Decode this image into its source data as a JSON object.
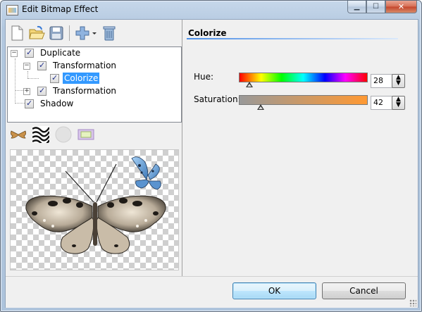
{
  "window": {
    "title": "Edit Bitmap Effect"
  },
  "tree": {
    "items": [
      {
        "label": "Duplicate"
      },
      {
        "label": "Transformation"
      },
      {
        "label": "Colorize"
      },
      {
        "label": "Transformation"
      },
      {
        "label": "Shadow"
      }
    ]
  },
  "panel": {
    "title": "Colorize",
    "hue": {
      "label": "Hue:",
      "value": "28",
      "position_fraction": 0.078
    },
    "saturation": {
      "label": "Saturation:",
      "value": "42",
      "position_fraction": 0.17
    }
  },
  "buttons": {
    "ok": "OK",
    "cancel": "Cancel"
  },
  "icons": [
    "new-document-icon",
    "open-folder-icon",
    "save-disk-icon",
    "add-plus-icon",
    "delete-trash-icon",
    "butterfly-thumb-icon",
    "zebra-stripes-icon",
    "circle-fade-icon",
    "frame-rectangle-icon"
  ],
  "colors": {
    "selection": "#3399ff",
    "accent_line": "#4c8ee6",
    "ok_button": "#bee6fd"
  }
}
